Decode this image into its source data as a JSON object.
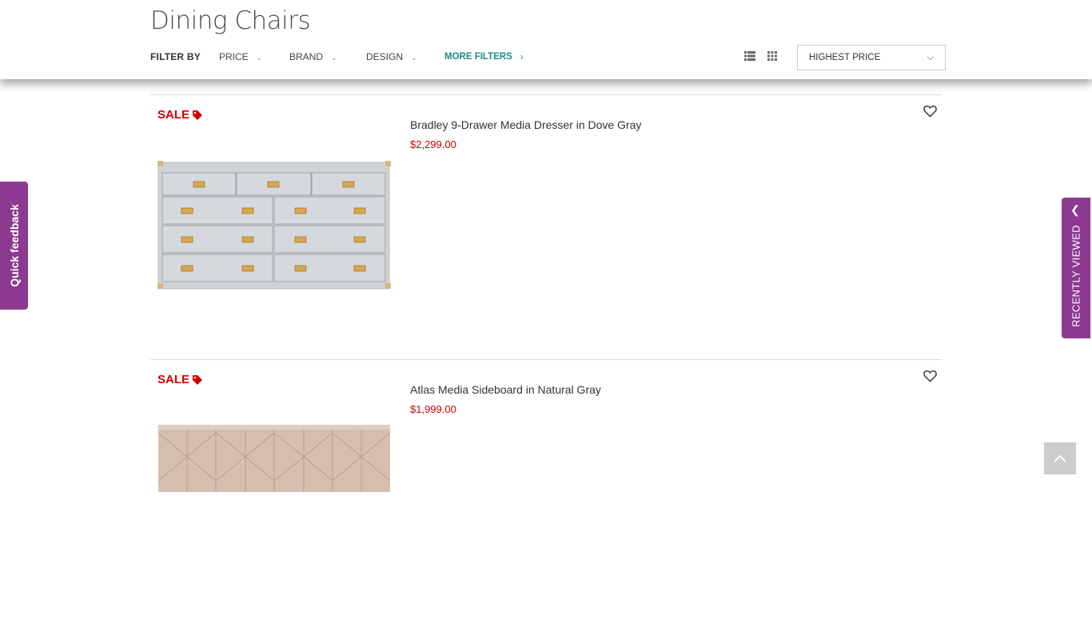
{
  "header": {
    "title": "Dining Chairs",
    "filter_by_label": "FILTER BY",
    "filters": [
      {
        "label": "PRICE"
      },
      {
        "label": "BRAND"
      },
      {
        "label": "DESIGN"
      }
    ],
    "more_filters_label": "MORE FILTERS",
    "sort": {
      "selected": "HIGHEST PRICE"
    }
  },
  "icons": {
    "list_view": "list-view-icon",
    "grid_view": "grid-view-icon",
    "tag": "tag-icon",
    "heart": "heart-icon"
  },
  "products": [
    {
      "sale_label": "SALE",
      "name": "Bradley 9-Drawer Media Dresser in Dove Gray",
      "price": "$2,299.00"
    },
    {
      "sale_label": "SALE",
      "name": "Atlas Media Sideboard in Natural Gray",
      "price": "$1,999.00"
    }
  ],
  "side_tabs": {
    "quick_feedback": "Quick feedback",
    "recently_viewed": "RECENTLY VIEWED"
  },
  "colors": {
    "accent_teal": "#1d8a8a",
    "sale_red": "#d10000",
    "tab_purple": "#8b3a8f"
  }
}
